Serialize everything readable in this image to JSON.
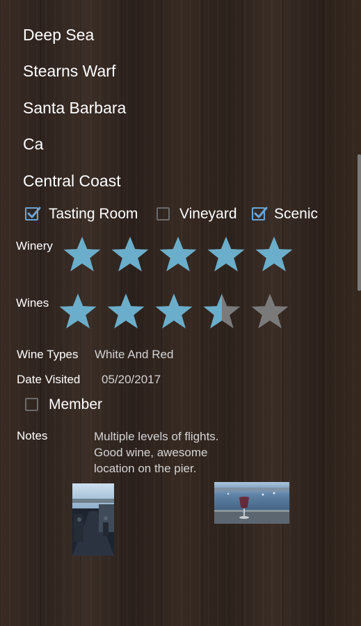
{
  "fields": {
    "name": "Deep Sea",
    "street": "Stearns Warf",
    "city": "Santa Barbara",
    "state": "Ca",
    "region": "Central Coast"
  },
  "features": [
    {
      "label": "Tasting Room",
      "checked": true
    },
    {
      "label": "Vineyard",
      "checked": false
    },
    {
      "label": "Scenic",
      "checked": true
    }
  ],
  "ratings": {
    "winery": {
      "label": "Winery",
      "value": 5,
      "max": 5
    },
    "wines": {
      "label": "Wines",
      "value": 3.5,
      "max": 5
    }
  },
  "wine_types": {
    "label": "Wine Types",
    "value": "White And Red"
  },
  "date_visited": {
    "label": "Date Visited",
    "value": "05/20/2017"
  },
  "member": {
    "label": "Member",
    "checked": false
  },
  "notes": {
    "label": "Notes",
    "value": "Multiple levels of flights.\nGood wine, awesome\nlocation on the pier."
  },
  "colors": {
    "star_filled": "#6aaecb",
    "star_empty": "#7a7a7a",
    "checkbox": "#6aa5d8"
  },
  "photos": [
    "pier-walkway-photo",
    "ocean-wine-glass-photo"
  ]
}
